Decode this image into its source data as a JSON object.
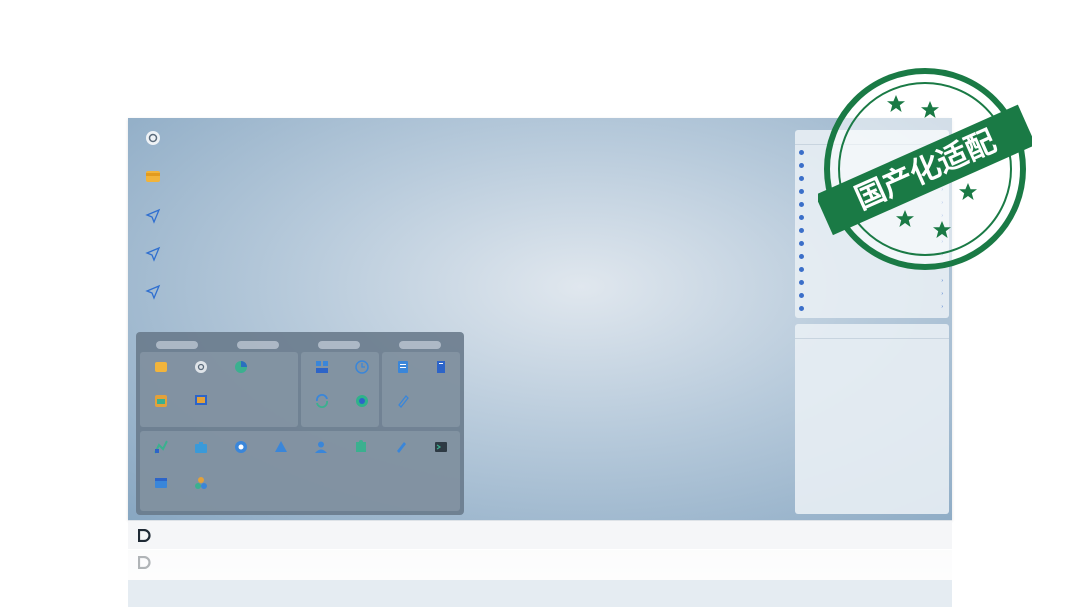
{
  "desktop": {
    "icons": [
      {
        "label": "",
        "icon": "settings-gear-icon"
      },
      {
        "label": "",
        "icon": "folder-icon"
      },
      {
        "label": "",
        "icon": "shortcut-arrow-icon"
      },
      {
        "label": "",
        "icon": "shortcut-arrow-icon"
      },
      {
        "label": "",
        "icon": "shortcut-arrow-icon"
      }
    ]
  },
  "start_menu": {
    "category_tabs": [
      "",
      "",
      "",
      ""
    ],
    "apps": [
      {
        "label": "",
        "icon": "folder-icon",
        "color": "#f2b43b"
      },
      {
        "label": "",
        "icon": "gear-icon",
        "color": "#dfe4e9"
      },
      {
        "label": "",
        "icon": "pie-chart-icon",
        "color": "#3bb08f"
      },
      {
        "label": "",
        "icon": "dashboard-icon",
        "color": "#3a86d9"
      },
      {
        "label": "",
        "icon": "clock-icon",
        "color": "#3a86d9"
      },
      {
        "label": "",
        "icon": "document-icon",
        "color": "#3a86d9"
      },
      {
        "label": "",
        "icon": "book-icon",
        "color": "#2d64c8"
      },
      {
        "label": "",
        "icon": "image-icon",
        "color": "#e3a13a"
      },
      {
        "label": "",
        "icon": "monitor-icon",
        "color": "#2d64c8"
      },
      {
        "label": "",
        "icon": "sync-icon",
        "color": "#3a86d9"
      },
      {
        "label": "",
        "icon": "globe-icon",
        "color": "#2fb28a"
      },
      {
        "label": "",
        "icon": "pen-icon",
        "color": "#3a86d9"
      },
      {
        "label": "",
        "icon": "chart-icon",
        "color": "#3bb08f"
      },
      {
        "label": "",
        "icon": "briefcase-icon",
        "color": "#3a9ad9"
      },
      {
        "label": "",
        "icon": "settings-icon",
        "color": "#3a86d9"
      },
      {
        "label": "",
        "icon": "network-icon",
        "color": "#3a86d9"
      },
      {
        "label": "",
        "icon": "user-icon",
        "color": "#3a86d9"
      },
      {
        "label": "",
        "icon": "puzzle-icon",
        "color": "#3bb08f"
      },
      {
        "label": "",
        "icon": "edit-icon",
        "color": "#3a86d9"
      },
      {
        "label": "",
        "icon": "terminal-icon",
        "color": "#2e3a44"
      },
      {
        "label": "",
        "icon": "window-icon",
        "color": "#3a86d9"
      },
      {
        "label": "",
        "icon": "grid-icon",
        "color": "#e3a13a"
      }
    ]
  },
  "service_panel": {
    "title": "",
    "rows": [
      "",
      "",
      "",
      "",
      "",
      "",
      "",
      "",
      "",
      "",
      "",
      "",
      ""
    ]
  },
  "log_panel": {
    "tabs": [
      "",
      ""
    ],
    "filters": [
      "",
      "",
      "",
      ""
    ],
    "link": "",
    "rows": [
      [
        "",
        "",
        ""
      ],
      [
        "",
        "",
        ""
      ],
      [
        "",
        "",
        ""
      ],
      [
        "",
        "",
        ""
      ],
      [
        "",
        "",
        ""
      ],
      [
        "",
        "",
        ""
      ],
      [
        "",
        "",
        ""
      ],
      [
        "",
        "",
        ""
      ],
      [
        "",
        "",
        ""
      ],
      [
        "",
        "",
        ""
      ],
      [
        "",
        "",
        ""
      ],
      [
        "",
        "",
        ""
      ],
      [
        "",
        "",
        ""
      ],
      [
        "",
        "",
        ""
      ],
      [
        "",
        "",
        ""
      ],
      [
        "",
        "",
        ""
      ],
      [
        "",
        "",
        ""
      ]
    ]
  },
  "taskbar": {
    "logo_icon": "d-logo-icon",
    "time": "",
    "date": ""
  },
  "stamp": {
    "text": "国产化适配",
    "color": "#1a7a45"
  }
}
